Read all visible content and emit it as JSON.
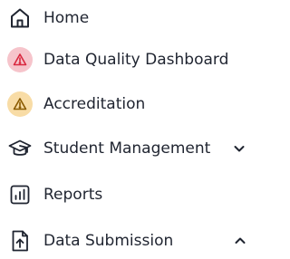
{
  "nav": {
    "items": [
      {
        "label": "Home",
        "icon": "home-icon"
      },
      {
        "label": "Data Quality Dashboard",
        "icon": "warning-icon",
        "badge_color": "#f6c4cb",
        "icon_color": "#d9283f"
      },
      {
        "label": "Accreditation",
        "icon": "warning-icon",
        "badge_color": "#f8dca6",
        "icon_color": "#8a5a00"
      },
      {
        "label": "Student Management",
        "icon": "graduation-cap-icon",
        "expand": "chevron-down-icon"
      },
      {
        "label": "Reports",
        "icon": "bar-chart-icon"
      },
      {
        "label": "Data Submission",
        "icon": "upload-file-icon",
        "expand": "chevron-up-icon"
      }
    ]
  }
}
